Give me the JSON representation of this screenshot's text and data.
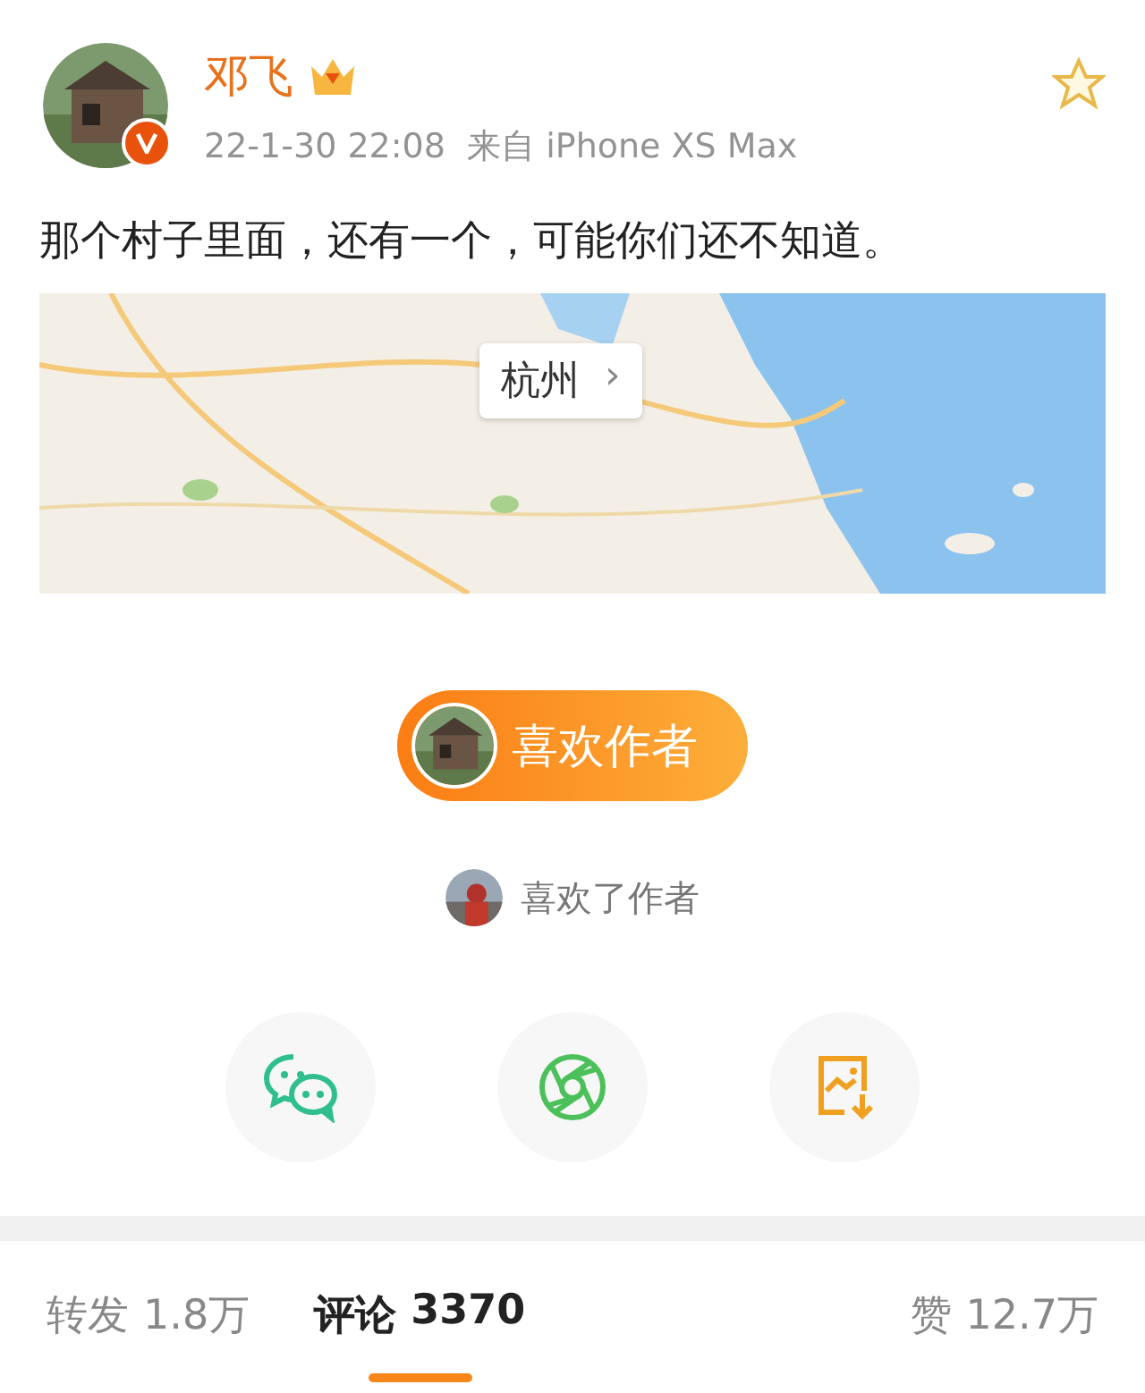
{
  "post": {
    "author": "邓飞",
    "time": "22-1-30 22:08",
    "source": "来自 iPhone XS Max",
    "starred": false,
    "text": "那个村子里面，还有一个，可能你们还不知道。"
  },
  "map": {
    "place": "杭州",
    "chevron": "›"
  },
  "like_author": {
    "label": "喜欢作者"
  },
  "liked_by": {
    "text": "喜欢了作者"
  },
  "share": [
    {
      "kind": "chat"
    },
    {
      "kind": "moments"
    },
    {
      "kind": "save-image"
    }
  ],
  "tabs": [
    {
      "label": "转发",
      "count": "1.8万",
      "selected": false
    },
    {
      "label": "评论",
      "count": "3370",
      "selected": true
    },
    {
      "label": "赞",
      "count": "12.7万",
      "selected": false
    }
  ]
}
